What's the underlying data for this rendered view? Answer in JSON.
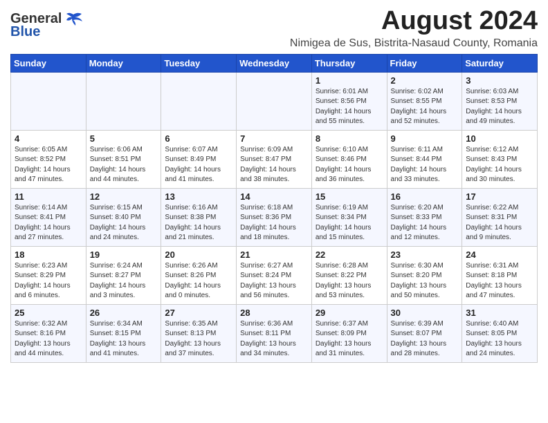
{
  "header": {
    "logo_general": "General",
    "logo_blue": "Blue",
    "title": "August 2024",
    "subtitle": "Nimigea de Sus, Bistrita-Nasaud County, Romania"
  },
  "weekdays": [
    "Sunday",
    "Monday",
    "Tuesday",
    "Wednesday",
    "Thursday",
    "Friday",
    "Saturday"
  ],
  "weeks": [
    [
      {
        "day": "",
        "info": ""
      },
      {
        "day": "",
        "info": ""
      },
      {
        "day": "",
        "info": ""
      },
      {
        "day": "",
        "info": ""
      },
      {
        "day": "1",
        "info": "Sunrise: 6:01 AM\nSunset: 8:56 PM\nDaylight: 14 hours\nand 55 minutes."
      },
      {
        "day": "2",
        "info": "Sunrise: 6:02 AM\nSunset: 8:55 PM\nDaylight: 14 hours\nand 52 minutes."
      },
      {
        "day": "3",
        "info": "Sunrise: 6:03 AM\nSunset: 8:53 PM\nDaylight: 14 hours\nand 49 minutes."
      }
    ],
    [
      {
        "day": "4",
        "info": "Sunrise: 6:05 AM\nSunset: 8:52 PM\nDaylight: 14 hours\nand 47 minutes."
      },
      {
        "day": "5",
        "info": "Sunrise: 6:06 AM\nSunset: 8:51 PM\nDaylight: 14 hours\nand 44 minutes."
      },
      {
        "day": "6",
        "info": "Sunrise: 6:07 AM\nSunset: 8:49 PM\nDaylight: 14 hours\nand 41 minutes."
      },
      {
        "day": "7",
        "info": "Sunrise: 6:09 AM\nSunset: 8:47 PM\nDaylight: 14 hours\nand 38 minutes."
      },
      {
        "day": "8",
        "info": "Sunrise: 6:10 AM\nSunset: 8:46 PM\nDaylight: 14 hours\nand 36 minutes."
      },
      {
        "day": "9",
        "info": "Sunrise: 6:11 AM\nSunset: 8:44 PM\nDaylight: 14 hours\nand 33 minutes."
      },
      {
        "day": "10",
        "info": "Sunrise: 6:12 AM\nSunset: 8:43 PM\nDaylight: 14 hours\nand 30 minutes."
      }
    ],
    [
      {
        "day": "11",
        "info": "Sunrise: 6:14 AM\nSunset: 8:41 PM\nDaylight: 14 hours\nand 27 minutes."
      },
      {
        "day": "12",
        "info": "Sunrise: 6:15 AM\nSunset: 8:40 PM\nDaylight: 14 hours\nand 24 minutes."
      },
      {
        "day": "13",
        "info": "Sunrise: 6:16 AM\nSunset: 8:38 PM\nDaylight: 14 hours\nand 21 minutes."
      },
      {
        "day": "14",
        "info": "Sunrise: 6:18 AM\nSunset: 8:36 PM\nDaylight: 14 hours\nand 18 minutes."
      },
      {
        "day": "15",
        "info": "Sunrise: 6:19 AM\nSunset: 8:34 PM\nDaylight: 14 hours\nand 15 minutes."
      },
      {
        "day": "16",
        "info": "Sunrise: 6:20 AM\nSunset: 8:33 PM\nDaylight: 14 hours\nand 12 minutes."
      },
      {
        "day": "17",
        "info": "Sunrise: 6:22 AM\nSunset: 8:31 PM\nDaylight: 14 hours\nand 9 minutes."
      }
    ],
    [
      {
        "day": "18",
        "info": "Sunrise: 6:23 AM\nSunset: 8:29 PM\nDaylight: 14 hours\nand 6 minutes."
      },
      {
        "day": "19",
        "info": "Sunrise: 6:24 AM\nSunset: 8:27 PM\nDaylight: 14 hours\nand 3 minutes."
      },
      {
        "day": "20",
        "info": "Sunrise: 6:26 AM\nSunset: 8:26 PM\nDaylight: 14 hours\nand 0 minutes."
      },
      {
        "day": "21",
        "info": "Sunrise: 6:27 AM\nSunset: 8:24 PM\nDaylight: 13 hours\nand 56 minutes."
      },
      {
        "day": "22",
        "info": "Sunrise: 6:28 AM\nSunset: 8:22 PM\nDaylight: 13 hours\nand 53 minutes."
      },
      {
        "day": "23",
        "info": "Sunrise: 6:30 AM\nSunset: 8:20 PM\nDaylight: 13 hours\nand 50 minutes."
      },
      {
        "day": "24",
        "info": "Sunrise: 6:31 AM\nSunset: 8:18 PM\nDaylight: 13 hours\nand 47 minutes."
      }
    ],
    [
      {
        "day": "25",
        "info": "Sunrise: 6:32 AM\nSunset: 8:16 PM\nDaylight: 13 hours\nand 44 minutes."
      },
      {
        "day": "26",
        "info": "Sunrise: 6:34 AM\nSunset: 8:15 PM\nDaylight: 13 hours\nand 41 minutes."
      },
      {
        "day": "27",
        "info": "Sunrise: 6:35 AM\nSunset: 8:13 PM\nDaylight: 13 hours\nand 37 minutes."
      },
      {
        "day": "28",
        "info": "Sunrise: 6:36 AM\nSunset: 8:11 PM\nDaylight: 13 hours\nand 34 minutes."
      },
      {
        "day": "29",
        "info": "Sunrise: 6:37 AM\nSunset: 8:09 PM\nDaylight: 13 hours\nand 31 minutes."
      },
      {
        "day": "30",
        "info": "Sunrise: 6:39 AM\nSunset: 8:07 PM\nDaylight: 13 hours\nand 28 minutes."
      },
      {
        "day": "31",
        "info": "Sunrise: 6:40 AM\nSunset: 8:05 PM\nDaylight: 13 hours\nand 24 minutes."
      }
    ]
  ]
}
